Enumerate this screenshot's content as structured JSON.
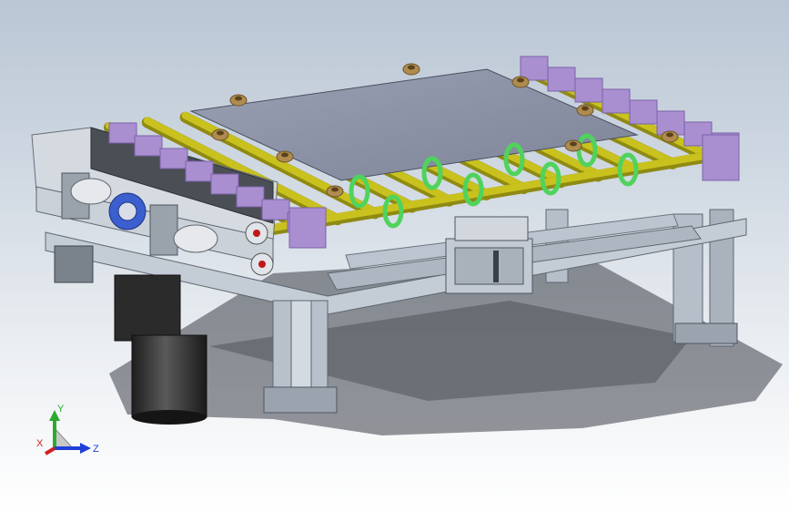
{
  "viewport": {
    "background_top": "#b9c6d4",
    "background_bottom": "#ffffff"
  },
  "model": {
    "colors": {
      "frame_aluminum": "#c4ccd6",
      "frame_dark": "#8a939e",
      "side_plate": "#d6dbe1",
      "rollers": "#c9c21e",
      "roller_dark": "#8f8a12",
      "end_blocks": "#a98fd0",
      "end_blocks_dark": "#7b62a8",
      "green_rings": "#4fd35c",
      "top_plate": "#8d94a8",
      "motor": "#3b3b3b",
      "bolt_heads": "#b08b4e",
      "red_accent": "#c01818",
      "shadow": "#3c4048"
    },
    "roller_count": 12
  },
  "triad": {
    "icon": "coordinate-triad-icon",
    "y_label": "Y",
    "x_label": "X",
    "z_label": "Z",
    "y_color": "#2fa82f",
    "x_color": "#d22020",
    "z_color": "#2040d8"
  }
}
